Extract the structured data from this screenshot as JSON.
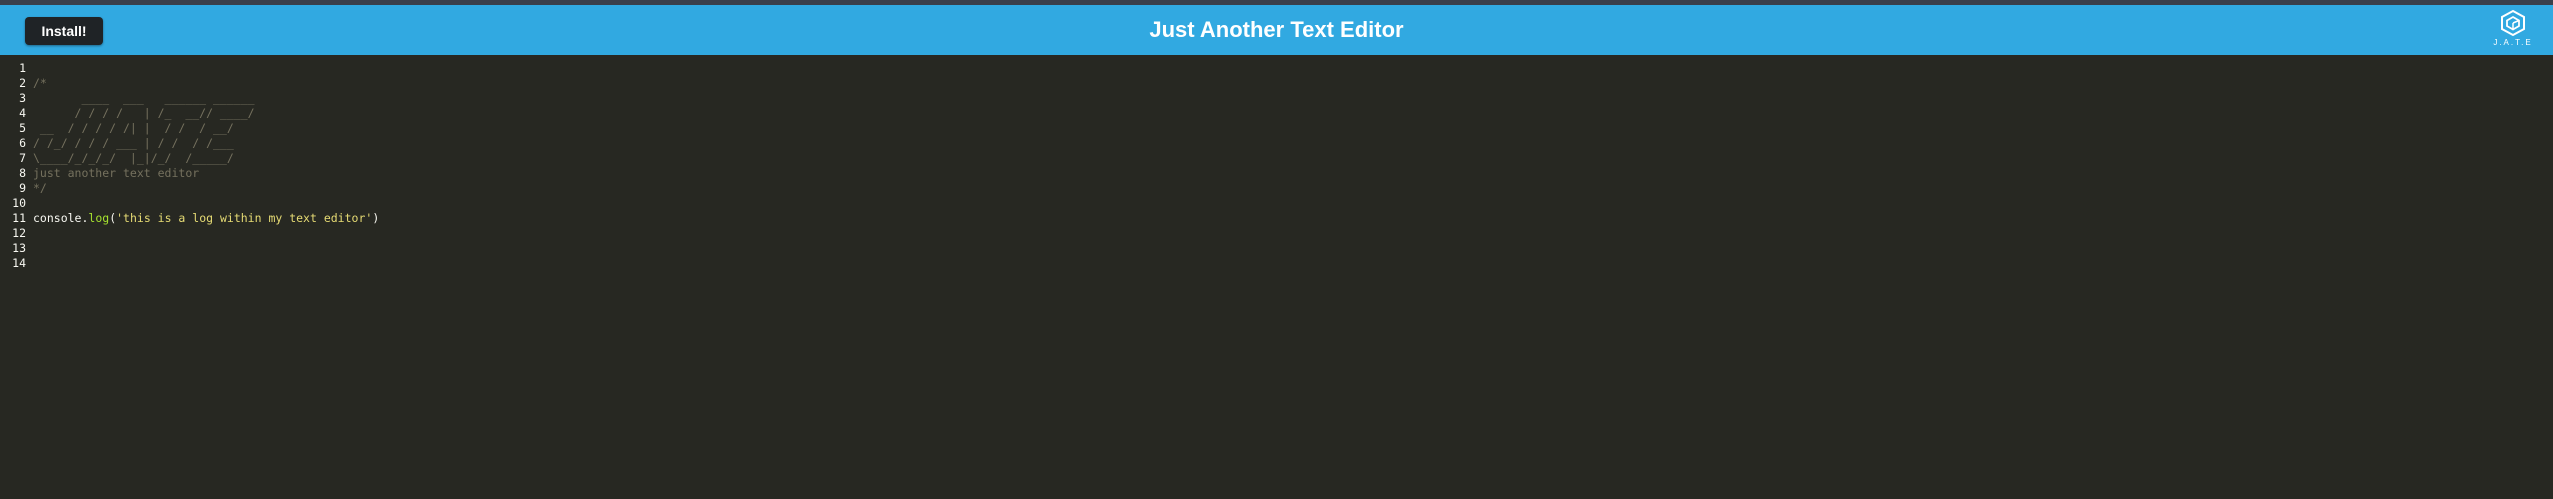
{
  "navbar": {
    "install_label": "Install!",
    "title": "Just Another Text Editor",
    "logo_text": "J.A.T.E",
    "logo_icon": "cube-logo-icon",
    "color": "#31a9e1"
  },
  "editor": {
    "theme": {
      "background": "#272822",
      "comment": "#75715e",
      "text": "#f8f8f2",
      "property": "#a6e22e",
      "string": "#e6db74"
    },
    "line_numbers": [
      "1",
      "2",
      "3",
      "4",
      "5",
      "6",
      "7",
      "8",
      "9",
      "10",
      "11",
      "12",
      "13",
      "14"
    ],
    "lines": {
      "l1": "",
      "l2": "/*",
      "l3": "       ____  ___   ______ ______",
      "l4": "      / / / /   | /_  __// ____/",
      "l5": " __  / / / / /| |  / /  / __/   ",
      "l6": "/ /_/ / / / ___ | / /  / /___   ",
      "l7": "\\____/_/_/_/  |_|/_/  /_____/   ",
      "l8": "just another text editor",
      "l9": "*/",
      "l10": "",
      "l11_obj": "console",
      "l11_dot": ".",
      "l11_method": "log",
      "l11_open": "(",
      "l11_string": "'this is a log within my text editor'",
      "l11_close": ")",
      "l12": "",
      "l13": "",
      "l14": ""
    }
  }
}
